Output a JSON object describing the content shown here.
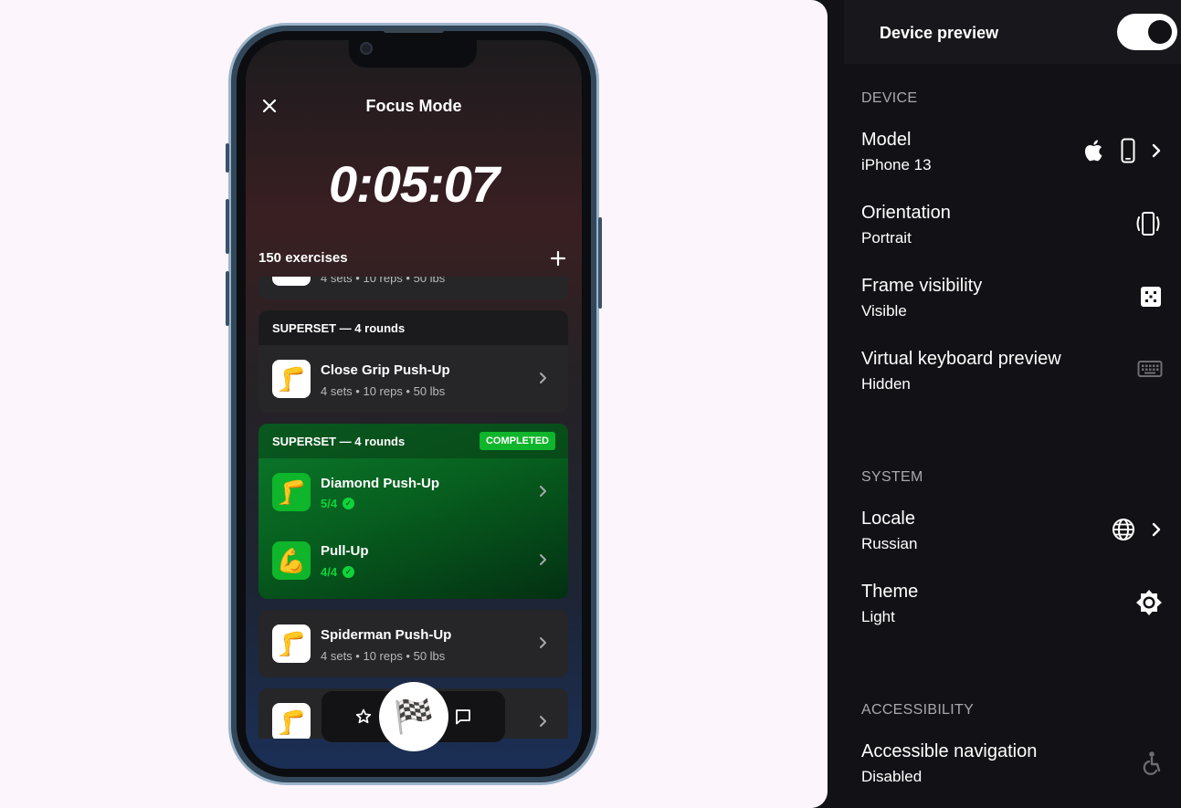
{
  "app": {
    "title": "Focus Mode",
    "timer": "0:05:07",
    "exercise_count": "150 exercises",
    "partial_meta": "4 sets • 10 reps • 50 lbs",
    "supersets": [
      {
        "header": "SUPERSET — 4 rounds",
        "exercises": [
          {
            "name": "Close Grip Push-Up",
            "meta": "4 sets • 10 reps • 50 lbs",
            "emoji": "🦵"
          }
        ]
      },
      {
        "header": "SUPERSET — 4 rounds",
        "badge": "COMPLETED",
        "exercises": [
          {
            "name": "Diamond Push-Up",
            "progress": "5/4",
            "emoji": "🦵"
          },
          {
            "name": "Pull-Up",
            "progress": "4/4",
            "emoji": "💪"
          }
        ]
      }
    ],
    "single": {
      "name": "Spiderman Push-Up",
      "meta": "4 sets • 10 reps • 50 lbs",
      "emoji": "🦵"
    },
    "last_emoji": "🦵",
    "fab_emoji": "🏁"
  },
  "panel": {
    "title": "Device preview",
    "sections": {
      "device": "DEVICE",
      "system": "SYSTEM",
      "accessibility": "ACCESSIBILITY"
    },
    "settings": {
      "model": {
        "label": "Model",
        "value": "iPhone 13"
      },
      "orientation": {
        "label": "Orientation",
        "value": "Portrait"
      },
      "frame": {
        "label": "Frame visibility",
        "value": "Visible"
      },
      "keyboard": {
        "label": "Virtual keyboard preview",
        "value": "Hidden"
      },
      "locale": {
        "label": "Locale",
        "value": "Russian"
      },
      "theme": {
        "label": "Theme",
        "value": "Light"
      },
      "a11y": {
        "label": "Accessible navigation",
        "value": "Disabled"
      }
    }
  },
  "colors": {
    "completed_green": "#0fb52b",
    "panel_bg": "#121116",
    "canvas_bg": "#fcf5fb"
  }
}
